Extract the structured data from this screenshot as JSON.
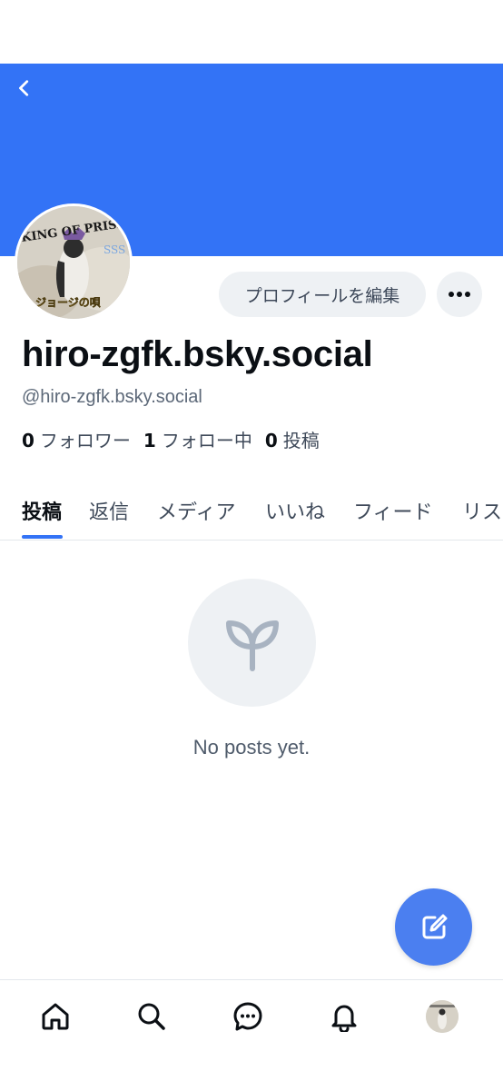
{
  "header": {
    "back_icon": "chevron-left-icon",
    "banner_color": "#3373f6"
  },
  "profile": {
    "avatar": {
      "top_text": "KING OF PRISM",
      "top_accent": "SSS",
      "bottom_text": "ジョージの唄"
    },
    "edit_label": "プロフィールを編集",
    "more_icon": "ellipsis-icon",
    "display_name": "hiro-zgfk.bsky.social",
    "handle": "@hiro-zgfk.bsky.social",
    "followers": {
      "count": "0",
      "label": "フォロワー"
    },
    "following": {
      "count": "1",
      "label": "フォロー中"
    },
    "posts": {
      "count": "0",
      "label": "投稿"
    }
  },
  "tabs": [
    {
      "label": "投稿",
      "active": true
    },
    {
      "label": "返信"
    },
    {
      "label": "メディア"
    },
    {
      "label": "いいね"
    },
    {
      "label": "フィード"
    },
    {
      "label": "リス"
    }
  ],
  "empty_state": {
    "icon": "sprout-icon",
    "text": "No posts yet."
  },
  "fab": {
    "icon": "compose-icon",
    "color": "#4b7ff0"
  },
  "bottom_nav": [
    {
      "icon": "home-icon"
    },
    {
      "icon": "search-icon"
    },
    {
      "icon": "chat-icon"
    },
    {
      "icon": "bell-icon"
    },
    {
      "icon": "profile-avatar"
    }
  ]
}
